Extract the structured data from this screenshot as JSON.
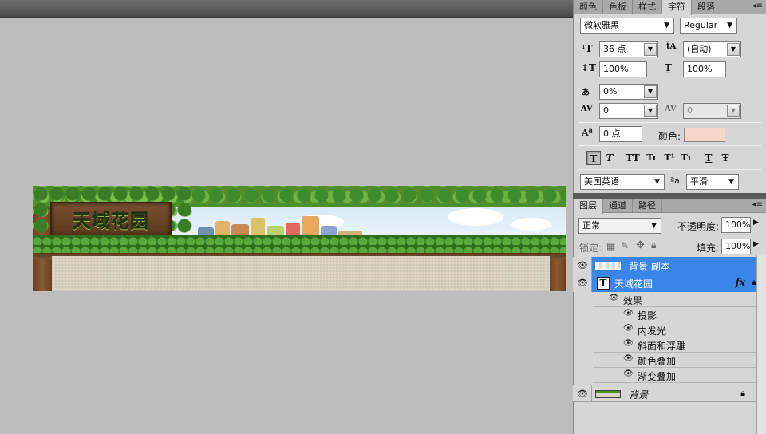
{
  "document": {
    "banner_text": "天域花园"
  },
  "char_panel": {
    "tabs": [
      "颜色",
      "色板",
      "样式",
      "字符",
      "段落"
    ],
    "active_tab": 3,
    "menu_icon": "panel-menu-icon",
    "font_family": "微软雅黑",
    "font_style": "Regular",
    "font_size": "36 点",
    "leading": "(自动)",
    "vertical_scale": "100%",
    "horizontal_scale": "100%",
    "tsume": "0%",
    "kerning": "0",
    "tracking": "0",
    "baseline_shift": "0 点",
    "color_label": "颜色:",
    "color_value": "#f8d6c8",
    "style_buttons": [
      "T",
      "T",
      "TT",
      "Tr",
      "T¹",
      "T₁",
      "T",
      "Ŧ"
    ],
    "language": "美国英语",
    "aa_label": "ªa",
    "antialias": "平滑"
  },
  "layers_panel": {
    "tabs": [
      "图层",
      "通道",
      "路径"
    ],
    "active_tab": 0,
    "blend_mode": "正常",
    "opacity_label": "不透明度:",
    "opacity": "100%",
    "lock_label": "锁定:",
    "fill_label": "填充:",
    "fill": "100%",
    "layers": [
      {
        "name": "背景 副本",
        "selected": true
      },
      {
        "name": "天域花园",
        "selected": true,
        "fx": "fx"
      },
      {
        "name": "背景",
        "selected": false
      }
    ],
    "effects_label": "效果",
    "effects": [
      "投影",
      "内发光",
      "斜面和浮雕",
      "颜色叠加",
      "渐变叠加"
    ]
  }
}
